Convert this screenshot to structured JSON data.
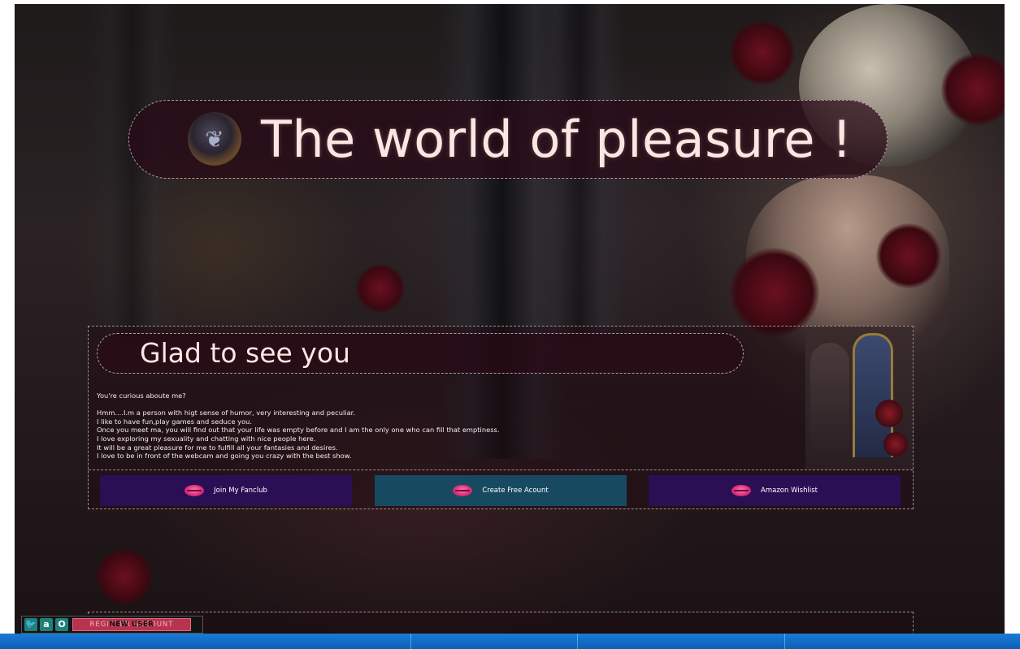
{
  "header": {
    "title": "The world of pleasure !",
    "avatar_icon": "panther-avatar-icon"
  },
  "intro": {
    "heading": "Glad to see you",
    "bio_lines": [
      "You're curious aboute me?",
      "",
      "Hmm....I.m a person with higt sense of humor, very interesting and peculiar.",
      "I like to have fun,play games and seduce you.",
      "Once you meet ma, you will find out that your life was empty before and I am the only one who can fill that emptiness.",
      "I love exploring my sexuality and chatting with nice people here.",
      "It will be a great pleasure for me to fulfill all your fantasies and desires.",
      "I love to be in front of the webcam and going you crazy with the best show."
    ]
  },
  "buttons": [
    {
      "label": "Join My Fanclub",
      "icon": "lips-icon",
      "color": "#2a0f55"
    },
    {
      "label": "Create Free Acount",
      "icon": "lips-icon",
      "color": "#174a60"
    },
    {
      "label": "Amazon Wishlist",
      "icon": "lips-icon",
      "color": "#2a0f55"
    }
  ],
  "footer": {
    "social_icons": [
      "twitter-icon",
      "amazon-icon",
      "onlyfans-icon"
    ],
    "register_label": "REGISTER ACCOUNT",
    "register_overlay": "NEW USER"
  },
  "colors": {
    "title_text": "#fbe6e2",
    "panel_border": "#a88a90",
    "register_bg": "#b8344d",
    "taskbar": "#0a5fb8"
  }
}
